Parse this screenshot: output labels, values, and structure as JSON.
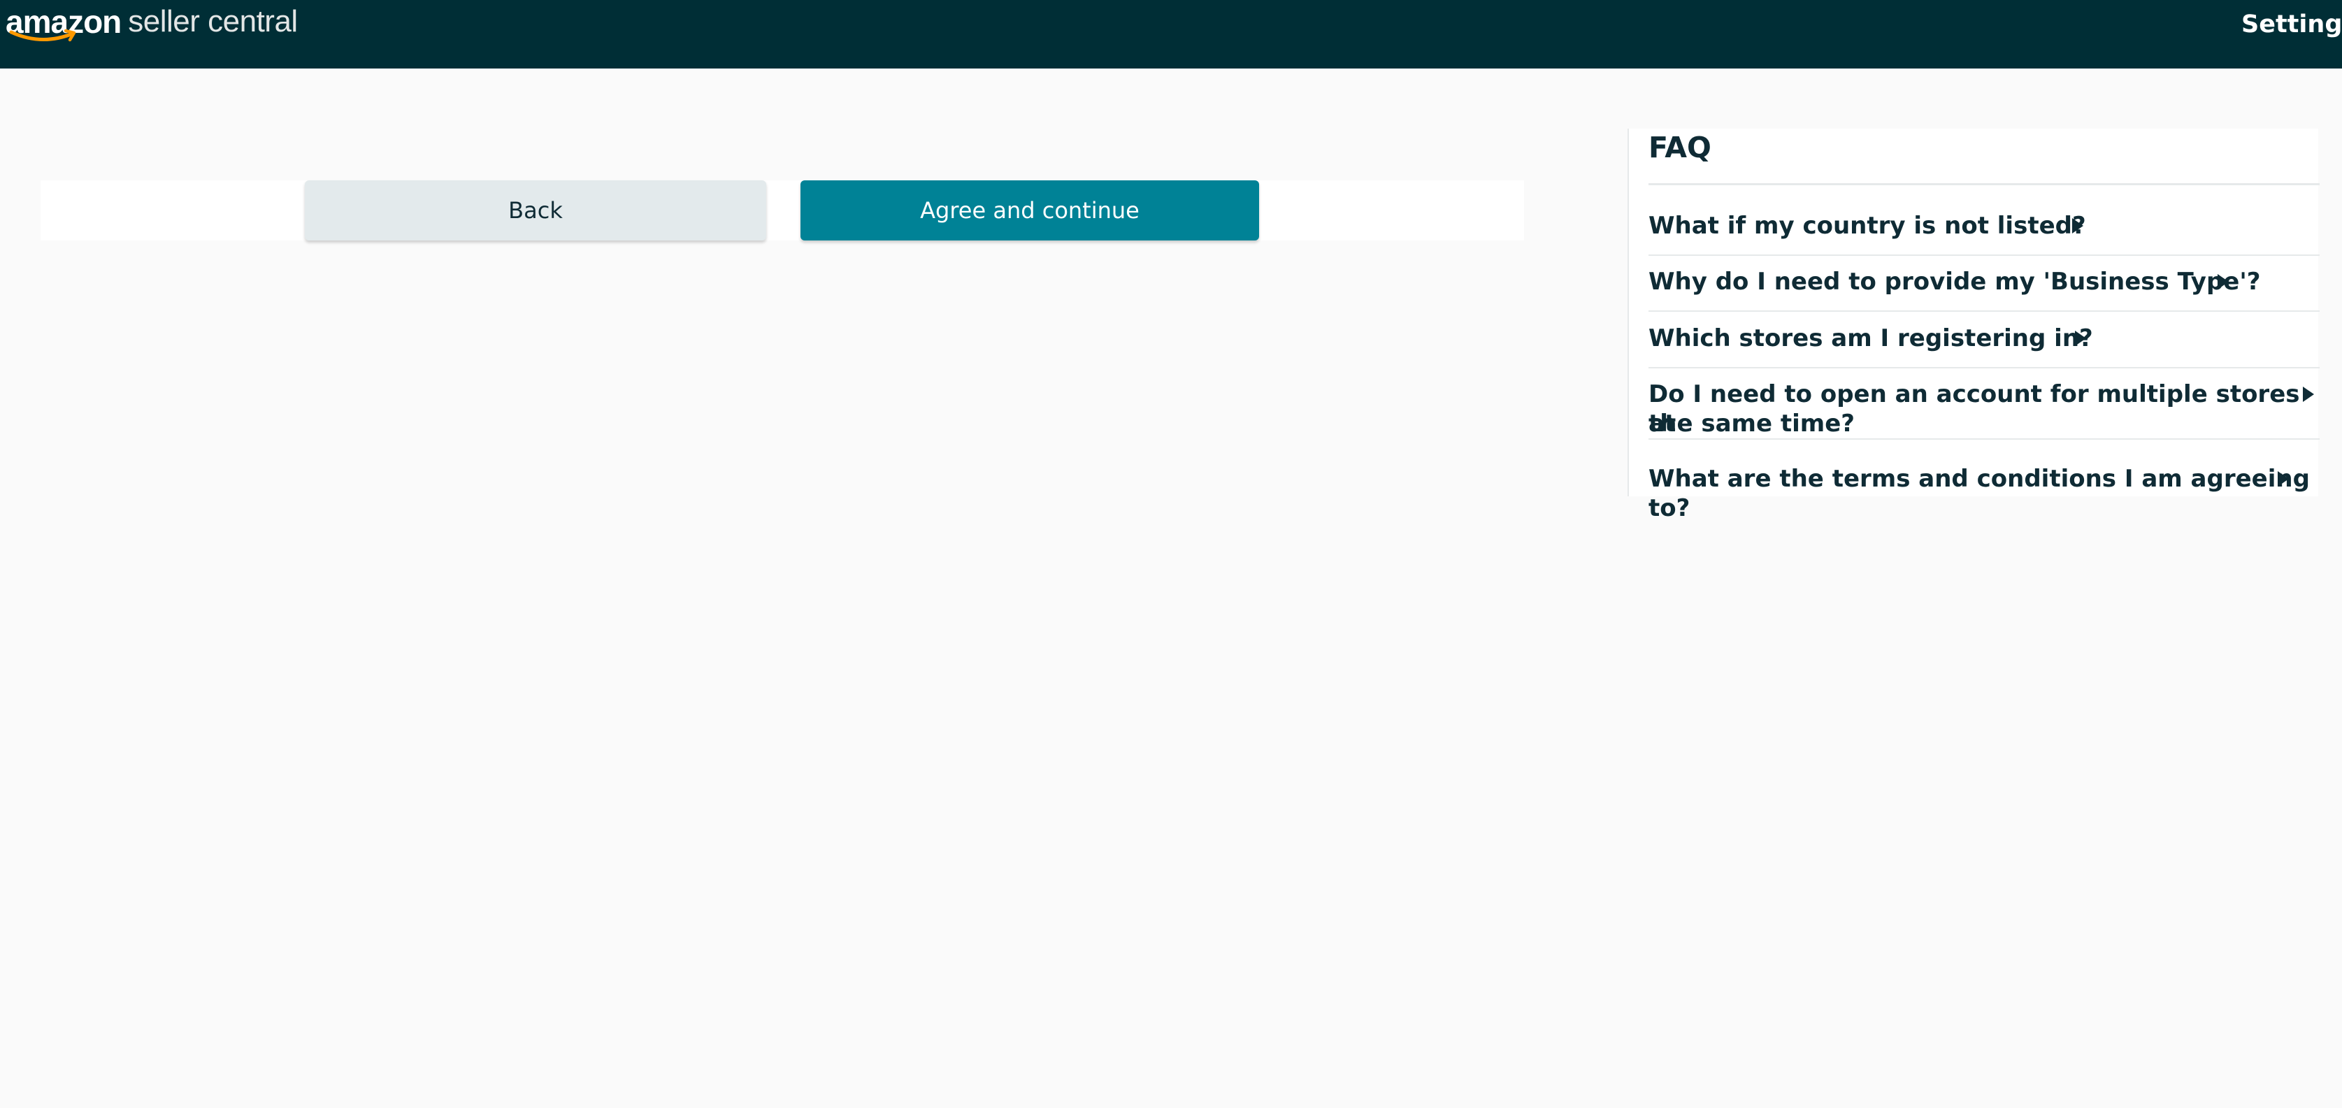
{
  "header": {
    "logo_word": "amazon",
    "logo_suffix": "seller central",
    "settings_label": "Settings"
  },
  "actions": {
    "back_label": "Back",
    "agree_label": "Agree and continue"
  },
  "faq": {
    "title": "FAQ",
    "items": [
      {
        "question": "What if my country is not listed?"
      },
      {
        "question": "Why do I need to provide my 'Business Type'?"
      },
      {
        "question": "Which stores am I registering in?"
      },
      {
        "question_line1": "Do I need to open an account for multiple stores at",
        "question_line2": "the same time?"
      },
      {
        "question": "What are the terms and conditions I am agreeing to?"
      }
    ]
  },
  "colors": {
    "header_bg": "#002e36",
    "page_bg": "#fafafa",
    "primary_button": "#008296",
    "secondary_button": "#e3eaec",
    "logo_smile": "#ff9900"
  }
}
